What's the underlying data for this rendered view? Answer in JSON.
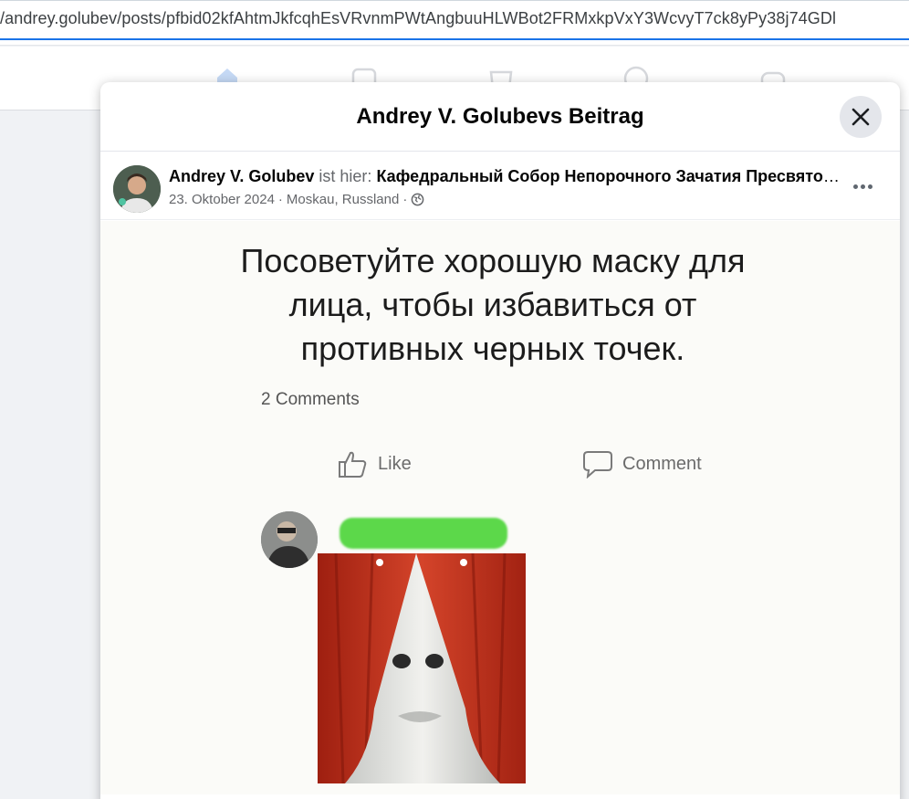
{
  "browser": {
    "url": "/andrey.golubev/posts/pfbid02kfAhtmJkfcqhEsVRvnmPWtAngbuuHLWBot2FRMxkpVxY3WcvyT7ck8yPy38j74GDl"
  },
  "nav": {
    "icons": [
      "home-icon",
      "video-icon",
      "marketplace-icon",
      "groups-icon",
      "gaming-icon"
    ]
  },
  "modal": {
    "title": "Andrey V. Golubevs Beitrag",
    "close_icon": "close-icon"
  },
  "post": {
    "author": "Andrey V. Golubev",
    "is_here": "ist hier:",
    "place": "Кафедральный Собор Непорочного Зачатия Пресвятой…",
    "date": "23. Oktober 2024",
    "location": "Moskau, Russland",
    "separator": "·",
    "audience_icon": "globe-icon",
    "more_icon": "more-options-icon"
  },
  "meme": {
    "text": "Посоветуйте хорошую маску для лица, чтобы избавиться от противных черных точек.",
    "comments_count": "2 Comments",
    "like_label": "Like",
    "comment_label": "Comment"
  }
}
